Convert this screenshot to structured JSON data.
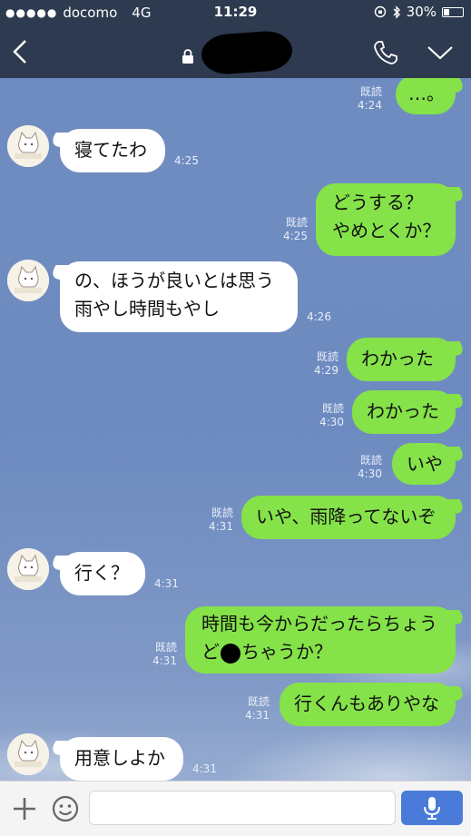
{
  "status": {
    "carrier": "docomo",
    "network": "4G",
    "time": "11:29",
    "battery": "30%",
    "battery_level": 0.3
  },
  "header": {
    "back_icon": "chevron-left-icon",
    "lock_icon": "lock-icon",
    "call_icon": "phone-icon",
    "menu_icon": "chevron-down-icon"
  },
  "messages": [
    {
      "side": "out",
      "text": "…。",
      "read": "既読",
      "time": "4:24"
    },
    {
      "side": "in",
      "text": "寝てたわ",
      "time": "4:25"
    },
    {
      "side": "out",
      "lines": [
        "どうする？",
        "やめとくか？"
      ],
      "read": "既読",
      "time": "4:25"
    },
    {
      "side": "in",
      "lines": [
        "の、ほうが良いとは思う",
        "雨やし時間もやし"
      ],
      "time": "4:26"
    },
    {
      "side": "out",
      "text": "わかった",
      "read": "既読",
      "time": "4:29"
    },
    {
      "side": "out",
      "text": "わかった",
      "read": "既読",
      "time": "4:30"
    },
    {
      "side": "out",
      "text": "いや",
      "read": "既読",
      "time": "4:30"
    },
    {
      "side": "out",
      "text": "いや、雨降ってないぞ",
      "read": "既読",
      "time": "4:31"
    },
    {
      "side": "in",
      "text": "行く？",
      "time": "4:31"
    },
    {
      "side": "out",
      "lines": [
        "時間も今からだったらちょう",
        "ど",
        "ちゃうか？"
      ],
      "read": "既読",
      "time": "4:31"
    },
    {
      "side": "out",
      "text": "行くんもありやな",
      "read": "既読",
      "time": "4:31"
    },
    {
      "side": "in",
      "text": "用意しよか",
      "time": "4:31"
    }
  ],
  "input": {
    "placeholder": ""
  },
  "colors": {
    "header": "#2d3a4f",
    "bubble_out": "#85e249",
    "bubble_in": "#ffffff",
    "send_button": "#4a7bd8"
  }
}
